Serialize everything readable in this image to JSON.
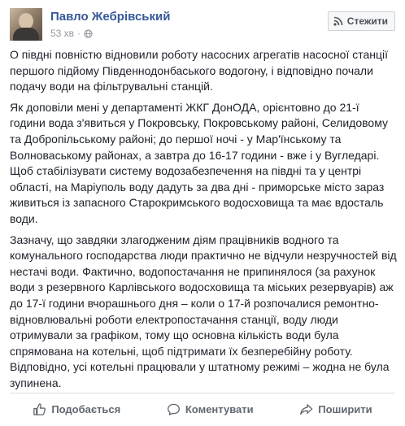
{
  "post": {
    "author": "Павло Жебрівський",
    "time": "53 хв",
    "follow_label": "Стежити",
    "paragraphs": [
      "О півдні повністю відновили роботу насосних агрегатів насосної станції першого підйому Південнодонбаського водогону, і відповідно почали подачу води на фільтрувальні станцій.",
      "Як доповіли мені у департаменті ЖКГ ДонОДА, орієнтовно до 21-ї години вода з'явиться у Покровську, Покровському районі, Селидовому та Добропільському районі; до першої ночі - у Мар'їнському та Волноваському районах, а завтра до 16-17 години - вже і у Вугледарі. Щоб стабілізувати систему водозабезпечення на півдні та у центрі області, на Маріуполь воду дадуть за два дні - приморське місто зараз живиться із запасного Старокримського водосховища та має вдосталь води.",
      "Зазначу, що завдяки злагодженим діям працівників водного та комунального господарства люди практично не відчули незручностей від нестачі води. Фактично, водопостачання не припинялося (за рахунок води з резервного Карлівського водосховища та міських резервуарів) аж до 17-ї години вчорашнього дня – коли о 17-й розпочалися ремонтно-відновлювальні роботи електропостачання станції, воду люди отримували за графіком, тому що основна кількість води була спрямована на котельні, щоб підтримати їх безперебійну роботу. Відповідно, усі котельні працювали у штатному режимі – жодна не була зупинена."
    ]
  },
  "actions": {
    "like_label": "Подобається",
    "comment_label": "Коментувати",
    "share_label": "Поширити"
  },
  "colors": {
    "link": "#365899",
    "meta": "#90949c",
    "action": "#606770",
    "text": "#1d2129"
  }
}
